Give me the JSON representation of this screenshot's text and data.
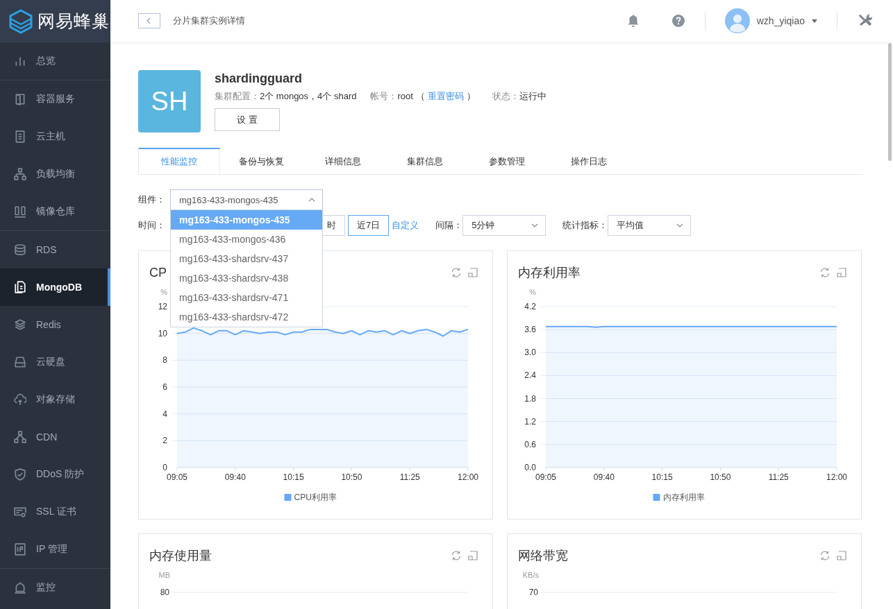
{
  "app": {
    "logo": "网易蜂巢"
  },
  "sidebar": {
    "groups": [
      [
        {
          "label": "总览",
          "selected": false
        }
      ],
      [
        {
          "label": "容器服务",
          "selected": false
        },
        {
          "label": "云主机",
          "selected": false
        },
        {
          "label": "负载均衡",
          "selected": false
        },
        {
          "label": "镜像仓库",
          "selected": false
        }
      ],
      [
        {
          "label": "RDS",
          "selected": false
        },
        {
          "label": "MongoDB",
          "selected": true
        },
        {
          "label": "Redis",
          "selected": false
        },
        {
          "label": "云硬盘",
          "selected": false
        },
        {
          "label": "对象存储",
          "selected": false
        },
        {
          "label": "CDN",
          "selected": false
        },
        {
          "label": "DDoS 防护",
          "selected": false
        },
        {
          "label": "SSL 证书",
          "selected": false
        },
        {
          "label": "IP 管理",
          "selected": false
        }
      ],
      [
        {
          "label": "监控",
          "selected": false
        }
      ]
    ]
  },
  "header": {
    "title": "分片集群实例详情",
    "user": {
      "name": "wzh_yiqiao"
    }
  },
  "instance": {
    "avatar": "SH",
    "name": "shardingguard",
    "fields": [
      {
        "label": "集群配置：",
        "value": "2个 mongos，4个 shard"
      },
      {
        "label": "帐号：",
        "value": "root",
        "paren_open": "（",
        "link": "重置密码",
        "paren_close": "）"
      },
      {
        "label": "状态：",
        "value": "运行中"
      }
    ],
    "settings_button": "设 置"
  },
  "tabs": [
    {
      "label": "性能监控",
      "selected": true
    },
    {
      "label": "备份与恢复",
      "selected": false
    },
    {
      "label": "详细信息",
      "selected": false
    },
    {
      "label": "集群信息",
      "selected": false
    },
    {
      "label": "参数管理",
      "selected": false
    },
    {
      "label": "操作日志",
      "selected": false
    }
  ],
  "filters": {
    "component": {
      "label": "组件：",
      "value": "mg163-433-mongos-435",
      "expanded": true,
      "options": [
        {
          "label": "mg163-433-mongos-435",
          "selected": true
        },
        {
          "label": "mg163-433-mongos-436",
          "selected": false
        },
        {
          "label": "mg163-433-shardsrv-437",
          "selected": false
        },
        {
          "label": "mg163-433-shardsrv-438",
          "selected": false
        },
        {
          "label": "mg163-433-shardsrv-471",
          "selected": false
        },
        {
          "label": "mg163-433-shardsrv-472",
          "selected": false
        }
      ]
    },
    "time": {
      "label": "时间：",
      "buttons": [
        {
          "label": "时",
          "selected": false
        },
        {
          "label": "近7日",
          "selected": true
        }
      ],
      "custom_link": "自定义"
    },
    "interval": {
      "label": "间隔：",
      "value": "5分钟"
    },
    "statistic": {
      "label": "统计指标：",
      "value": "平均值"
    }
  },
  "charts": [
    {
      "title": "CP",
      "chart_data": {
        "type": "area",
        "grid": true,
        "ylabel": "%",
        "ylim": [
          0,
          12
        ],
        "yticks": [
          0,
          2,
          4,
          6,
          8,
          10,
          12
        ],
        "categories": [
          "09:05",
          null,
          null,
          null,
          null,
          null,
          null,
          "09:40",
          null,
          null,
          null,
          null,
          null,
          null,
          "10:15",
          null,
          null,
          null,
          null,
          null,
          null,
          "10:50",
          null,
          null,
          null,
          null,
          null,
          null,
          "11:25",
          null,
          null,
          null,
          null,
          null,
          null,
          "12:00"
        ],
        "series": [
          {
            "name": "CPU利用率",
            "color": "#66a9f5",
            "values": [
              10.0,
              10.1,
              10.4,
              10.2,
              9.9,
              10.2,
              10.2,
              9.9,
              10.2,
              10.1,
              10.0,
              10.1,
              10.1,
              9.9,
              10.1,
              10.1,
              10.3,
              10.3,
              10.3,
              10.1,
              10.0,
              10.2,
              9.9,
              10.2,
              10.1,
              10.2,
              9.9,
              10.2,
              10.0,
              10.2,
              10.3,
              10.1,
              9.8,
              10.2,
              10.1,
              10.3
            ]
          }
        ]
      }
    },
    {
      "title": "内存利用率",
      "chart_data": {
        "type": "area",
        "grid": true,
        "ylabel": "%",
        "ylim": [
          0,
          4.2
        ],
        "yticks": [
          {
            "value": 0,
            "label": "0.0"
          },
          0.6,
          1.2,
          1.8,
          2.4,
          {
            "value": 3,
            "label": "3.0"
          },
          3.6,
          4.2
        ],
        "categories": [
          "09:05",
          null,
          null,
          null,
          null,
          null,
          null,
          "09:40",
          null,
          null,
          null,
          null,
          null,
          null,
          "10:15",
          null,
          null,
          null,
          null,
          null,
          null,
          "10:50",
          null,
          null,
          null,
          null,
          null,
          null,
          "11:25",
          null,
          null,
          null,
          null,
          null,
          null,
          "12:00"
        ],
        "series": [
          {
            "name": "内存利用率",
            "color": "#66a9f5",
            "values": [
              3.68,
              3.68,
              3.68,
              3.68,
              3.68,
              3.68,
              3.66,
              3.68,
              3.68,
              3.68,
              3.68,
              3.68,
              3.68,
              3.68,
              3.68,
              3.68,
              3.68,
              3.68,
              3.68,
              3.68,
              3.68,
              3.68,
              3.68,
              3.68,
              3.68,
              3.68,
              3.68,
              3.68,
              3.68,
              3.68,
              3.68,
              3.68,
              3.68,
              3.68,
              3.68,
              3.68
            ]
          }
        ]
      }
    },
    {
      "title": "内存使用量",
      "unit": "MB",
      "top_tick": "80"
    },
    {
      "title": "网络带宽",
      "unit": "KB/s",
      "top_tick": "70"
    }
  ]
}
